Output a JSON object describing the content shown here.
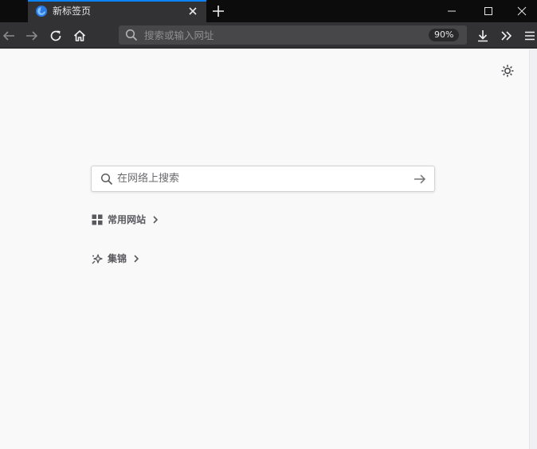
{
  "tab": {
    "title": "新标签页"
  },
  "toolbar": {
    "url_placeholder": "搜索或输入网址",
    "zoom": "90%"
  },
  "search": {
    "placeholder": "在网络上搜索"
  },
  "sections": {
    "topsites_label": "常用网站",
    "highlights_label": "集锦"
  },
  "colors": {
    "accent": "#0a84ff",
    "tabstrip_bg": "#0c0c0d",
    "toolbar_bg": "#323234",
    "content_bg": "#f9f9fa"
  },
  "icons": {
    "favicon": "firefox-icon",
    "close": "close-icon",
    "new_tab": "plus-icon",
    "back": "back-arrow-icon",
    "forward": "forward-arrow-icon",
    "reload": "reload-icon",
    "home": "home-icon",
    "url_search": "search-icon",
    "downloads": "download-icon",
    "overflow": "chevron-double-right-icon",
    "menu": "hamburger-menu-icon",
    "settings": "gear-icon",
    "go": "arrow-right-icon",
    "topsites": "grid-icon",
    "highlights": "sparkle-icon",
    "chevron": "chevron-right-icon"
  }
}
